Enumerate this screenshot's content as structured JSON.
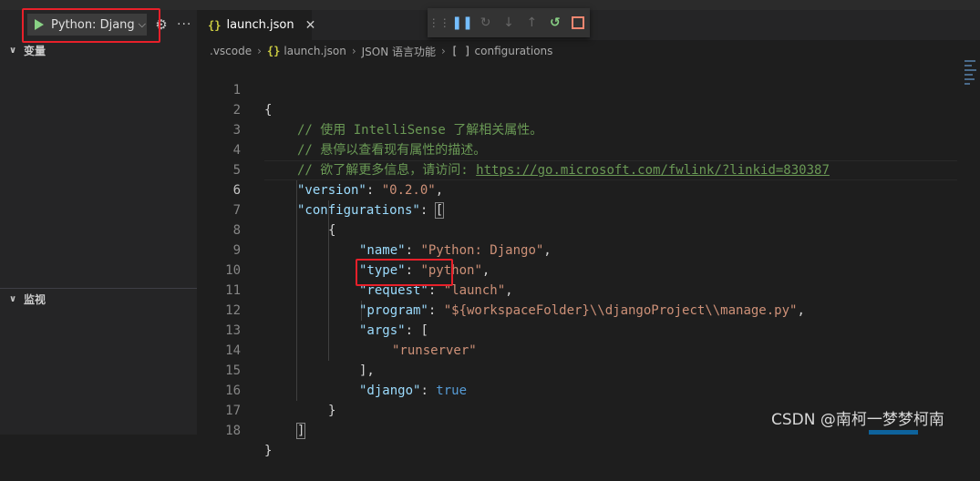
{
  "run_config": {
    "label": "Python: Djang"
  },
  "sidebar": {
    "variables_title": "变量",
    "watch_title": "监视"
  },
  "tab": {
    "label": "launch.json",
    "icon": "{}",
    "close": "✕"
  },
  "breadcrumb": {
    "folder": ".vscode",
    "file_icon": "{}",
    "file": "launch.json",
    "lang": "JSON 语言功能",
    "symbol_icon": "[ ]",
    "symbol": "configurations"
  },
  "line_numbers": [
    "1",
    "2",
    "3",
    "4",
    "5",
    "6",
    "7",
    "8",
    "9",
    "10",
    "11",
    "12",
    "13",
    "14",
    "15",
    "16",
    "17",
    "18"
  ],
  "code": {
    "l1": "{",
    "l2": "// 使用 IntelliSense 了解相关属性。",
    "l3": "// 悬停以查看现有属性的描述。",
    "l4_prefix": "// 欲了解更多信息，请访问: ",
    "l4_link": "https://go.microsoft.com/fwlink/?linkid=830387",
    "l5_key": "\"version\"",
    "l5_val": "\"0.2.0\"",
    "l6_key": "\"configurations\"",
    "l6_br": "[",
    "l7": "{",
    "l8_key": "\"name\"",
    "l8_val": "\"Python: Django\"",
    "l9_key": "\"type\"",
    "l9_val": "\"python\"",
    "l10_key": "\"request\"",
    "l10_val": "\"launch\"",
    "l11_key": "\"program\"",
    "l11_val": "\"${workspaceFolder}\\\\djangoProject\\\\manage.py\"",
    "l12_key": "\"args\"",
    "l12_br": "[",
    "l13_val": "\"runserver\"",
    "l14": "],",
    "l15_key": "\"django\"",
    "l15_val": "true",
    "l16": "}",
    "l17": "]",
    "l18": "}"
  },
  "watermark": "CSDN @南柯一梦梦柯南",
  "colors": {
    "comment": "#6a9955",
    "key": "#9cdcfe",
    "string": "#ce9178",
    "boolean": "#569cd6",
    "highlight_box": "#e8202a"
  },
  "icons": {
    "run": "play-icon",
    "settings": "gear-icon",
    "more": "ellipsis-icon",
    "debug_toolbar": [
      "drag-handle-icon",
      "pause-icon",
      "step-over-icon",
      "step-into-icon",
      "step-out-icon",
      "restart-icon",
      "stop-icon"
    ]
  }
}
